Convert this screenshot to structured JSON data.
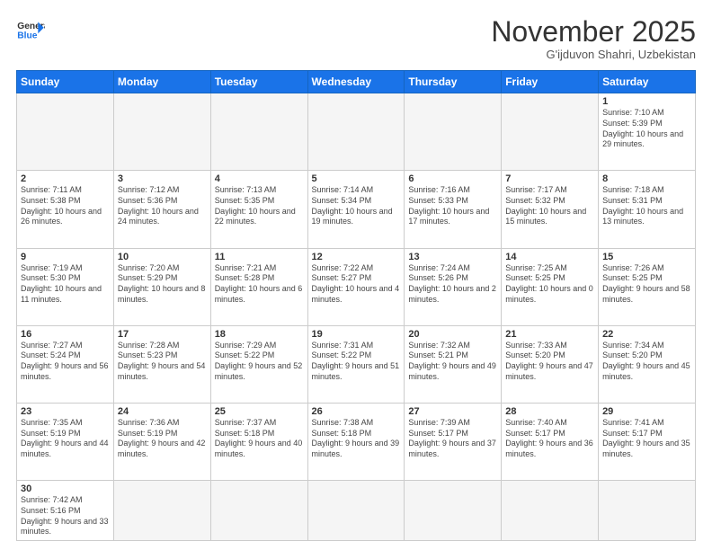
{
  "header": {
    "logo_general": "General",
    "logo_blue": "Blue",
    "month_title": "November 2025",
    "location": "G'ijduvon Shahri, Uzbekistan"
  },
  "weekdays": [
    "Sunday",
    "Monday",
    "Tuesday",
    "Wednesday",
    "Thursday",
    "Friday",
    "Saturday"
  ],
  "weeks": [
    [
      {
        "day": "",
        "info": ""
      },
      {
        "day": "",
        "info": ""
      },
      {
        "day": "",
        "info": ""
      },
      {
        "day": "",
        "info": ""
      },
      {
        "day": "",
        "info": ""
      },
      {
        "day": "",
        "info": ""
      },
      {
        "day": "1",
        "info": "Sunrise: 7:10 AM\nSunset: 5:39 PM\nDaylight: 10 hours and 29 minutes."
      }
    ],
    [
      {
        "day": "2",
        "info": "Sunrise: 7:11 AM\nSunset: 5:38 PM\nDaylight: 10 hours and 26 minutes."
      },
      {
        "day": "3",
        "info": "Sunrise: 7:12 AM\nSunset: 5:36 PM\nDaylight: 10 hours and 24 minutes."
      },
      {
        "day": "4",
        "info": "Sunrise: 7:13 AM\nSunset: 5:35 PM\nDaylight: 10 hours and 22 minutes."
      },
      {
        "day": "5",
        "info": "Sunrise: 7:14 AM\nSunset: 5:34 PM\nDaylight: 10 hours and 19 minutes."
      },
      {
        "day": "6",
        "info": "Sunrise: 7:16 AM\nSunset: 5:33 PM\nDaylight: 10 hours and 17 minutes."
      },
      {
        "day": "7",
        "info": "Sunrise: 7:17 AM\nSunset: 5:32 PM\nDaylight: 10 hours and 15 minutes."
      },
      {
        "day": "8",
        "info": "Sunrise: 7:18 AM\nSunset: 5:31 PM\nDaylight: 10 hours and 13 minutes."
      }
    ],
    [
      {
        "day": "9",
        "info": "Sunrise: 7:19 AM\nSunset: 5:30 PM\nDaylight: 10 hours and 11 minutes."
      },
      {
        "day": "10",
        "info": "Sunrise: 7:20 AM\nSunset: 5:29 PM\nDaylight: 10 hours and 8 minutes."
      },
      {
        "day": "11",
        "info": "Sunrise: 7:21 AM\nSunset: 5:28 PM\nDaylight: 10 hours and 6 minutes."
      },
      {
        "day": "12",
        "info": "Sunrise: 7:22 AM\nSunset: 5:27 PM\nDaylight: 10 hours and 4 minutes."
      },
      {
        "day": "13",
        "info": "Sunrise: 7:24 AM\nSunset: 5:26 PM\nDaylight: 10 hours and 2 minutes."
      },
      {
        "day": "14",
        "info": "Sunrise: 7:25 AM\nSunset: 5:25 PM\nDaylight: 10 hours and 0 minutes."
      },
      {
        "day": "15",
        "info": "Sunrise: 7:26 AM\nSunset: 5:25 PM\nDaylight: 9 hours and 58 minutes."
      }
    ],
    [
      {
        "day": "16",
        "info": "Sunrise: 7:27 AM\nSunset: 5:24 PM\nDaylight: 9 hours and 56 minutes."
      },
      {
        "day": "17",
        "info": "Sunrise: 7:28 AM\nSunset: 5:23 PM\nDaylight: 9 hours and 54 minutes."
      },
      {
        "day": "18",
        "info": "Sunrise: 7:29 AM\nSunset: 5:22 PM\nDaylight: 9 hours and 52 minutes."
      },
      {
        "day": "19",
        "info": "Sunrise: 7:31 AM\nSunset: 5:22 PM\nDaylight: 9 hours and 51 minutes."
      },
      {
        "day": "20",
        "info": "Sunrise: 7:32 AM\nSunset: 5:21 PM\nDaylight: 9 hours and 49 minutes."
      },
      {
        "day": "21",
        "info": "Sunrise: 7:33 AM\nSunset: 5:20 PM\nDaylight: 9 hours and 47 minutes."
      },
      {
        "day": "22",
        "info": "Sunrise: 7:34 AM\nSunset: 5:20 PM\nDaylight: 9 hours and 45 minutes."
      }
    ],
    [
      {
        "day": "23",
        "info": "Sunrise: 7:35 AM\nSunset: 5:19 PM\nDaylight: 9 hours and 44 minutes."
      },
      {
        "day": "24",
        "info": "Sunrise: 7:36 AM\nSunset: 5:19 PM\nDaylight: 9 hours and 42 minutes."
      },
      {
        "day": "25",
        "info": "Sunrise: 7:37 AM\nSunset: 5:18 PM\nDaylight: 9 hours and 40 minutes."
      },
      {
        "day": "26",
        "info": "Sunrise: 7:38 AM\nSunset: 5:18 PM\nDaylight: 9 hours and 39 minutes."
      },
      {
        "day": "27",
        "info": "Sunrise: 7:39 AM\nSunset: 5:17 PM\nDaylight: 9 hours and 37 minutes."
      },
      {
        "day": "28",
        "info": "Sunrise: 7:40 AM\nSunset: 5:17 PM\nDaylight: 9 hours and 36 minutes."
      },
      {
        "day": "29",
        "info": "Sunrise: 7:41 AM\nSunset: 5:17 PM\nDaylight: 9 hours and 35 minutes."
      }
    ],
    [
      {
        "day": "30",
        "info": "Sunrise: 7:42 AM\nSunset: 5:16 PM\nDaylight: 9 hours and 33 minutes."
      },
      {
        "day": "",
        "info": ""
      },
      {
        "day": "",
        "info": ""
      },
      {
        "day": "",
        "info": ""
      },
      {
        "day": "",
        "info": ""
      },
      {
        "day": "",
        "info": ""
      },
      {
        "day": "",
        "info": ""
      }
    ]
  ]
}
